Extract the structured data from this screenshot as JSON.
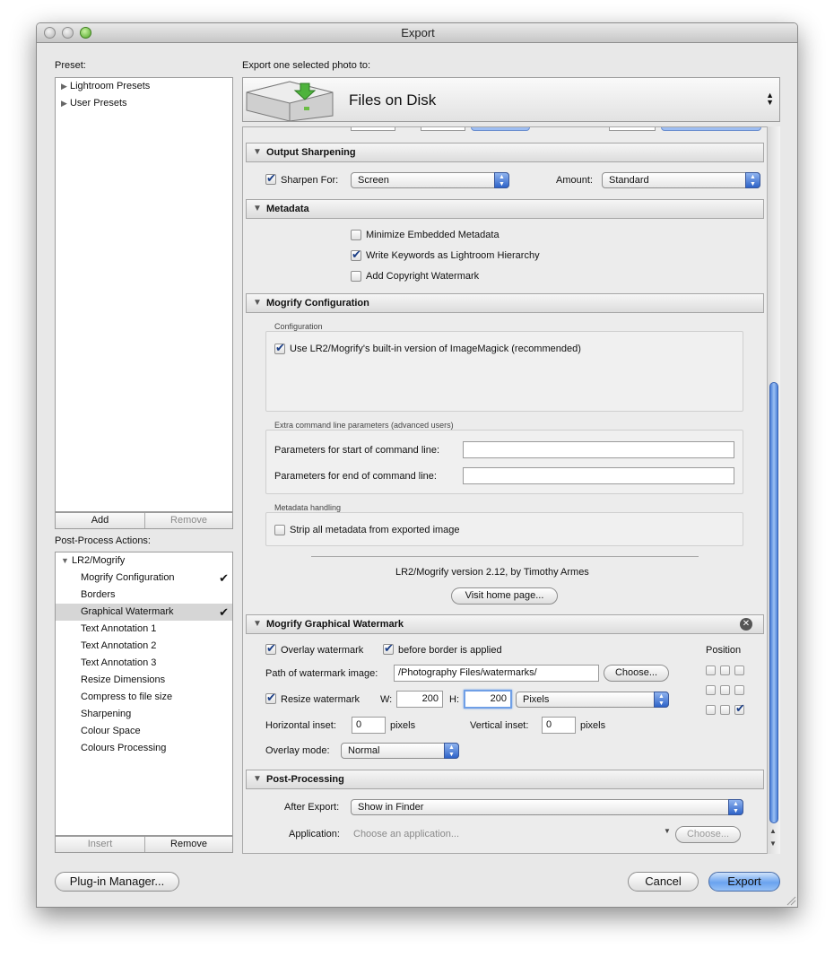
{
  "window": {
    "title": "Export"
  },
  "left": {
    "preset_label": "Preset:",
    "presets": [
      "Lightroom Presets",
      "User Presets"
    ],
    "add": "Add",
    "remove": "Remove",
    "post_label": "Post-Process Actions:",
    "post_root": "LR2/Mogrify",
    "post_items": [
      {
        "label": "Mogrify Configuration",
        "checked": true
      },
      {
        "label": "Borders",
        "checked": false
      },
      {
        "label": "Graphical Watermark",
        "checked": true
      },
      {
        "label": "Text Annotation 1",
        "checked": false
      },
      {
        "label": "Text Annotation 2",
        "checked": false
      },
      {
        "label": "Text Annotation 3",
        "checked": false
      },
      {
        "label": "Resize Dimensions",
        "checked": false
      },
      {
        "label": "Compress to file size",
        "checked": false
      },
      {
        "label": "Sharpening",
        "checked": false
      },
      {
        "label": "Colour Space",
        "checked": false
      },
      {
        "label": "Colours Processing",
        "checked": false
      }
    ],
    "checkmark": "✔",
    "insert": "Insert",
    "remove2": "Remove"
  },
  "right": {
    "export_label": "Export one selected photo to:",
    "destination": "Files on Disk",
    "sharpening": {
      "title": "Output Sharpening",
      "sharpen_for_label": "Sharpen For:",
      "sharpen_for": "Screen",
      "amount_label": "Amount:",
      "amount": "Standard"
    },
    "metadata": {
      "title": "Metadata",
      "minimize": "Minimize Embedded Metadata",
      "keywords": "Write Keywords as Lightroom Hierarchy",
      "copyright": "Add Copyright Watermark"
    },
    "mogrify": {
      "title": "Mogrify Configuration",
      "config_label": "Configuration",
      "builtin": "Use LR2/Mogrify's built-in version of ImageMagick (recommended)",
      "extra_label": "Extra command line parameters (advanced users)",
      "start_label": "Parameters for start of command line:",
      "end_label": "Parameters for end of command line:",
      "meta_label": "Metadata handling",
      "strip": "Strip all metadata from exported image",
      "version": "LR2/Mogrify version 2.12, by Timothy Armes",
      "visit": "Visit home page..."
    },
    "watermark": {
      "title": "Mogrify Graphical Watermark",
      "overlay": "Overlay watermark",
      "before_border": "before border is applied",
      "position_label": "Position",
      "path_label": "Path of watermark image:",
      "path": "/Photography Files/watermarks/",
      "choose": "Choose...",
      "resize": "Resize watermark",
      "w_label": "W:",
      "w": "200",
      "h_label": "H:",
      "h": "200",
      "units": "Pixels",
      "h_inset_label": "Horizontal inset:",
      "h_inset": "0",
      "pixels1": "pixels",
      "v_inset_label": "Vertical inset:",
      "v_inset": "0",
      "pixels2": "pixels",
      "overlay_mode_label": "Overlay mode:",
      "overlay_mode": "Normal"
    },
    "post": {
      "title": "Post-Processing",
      "after_label": "After Export:",
      "after": "Show in Finder",
      "app_label": "Application:",
      "app_placeholder": "Choose an application...",
      "choose": "Choose..."
    }
  },
  "footer": {
    "plugin_manager": "Plug-in Manager...",
    "cancel": "Cancel",
    "export": "Export"
  }
}
